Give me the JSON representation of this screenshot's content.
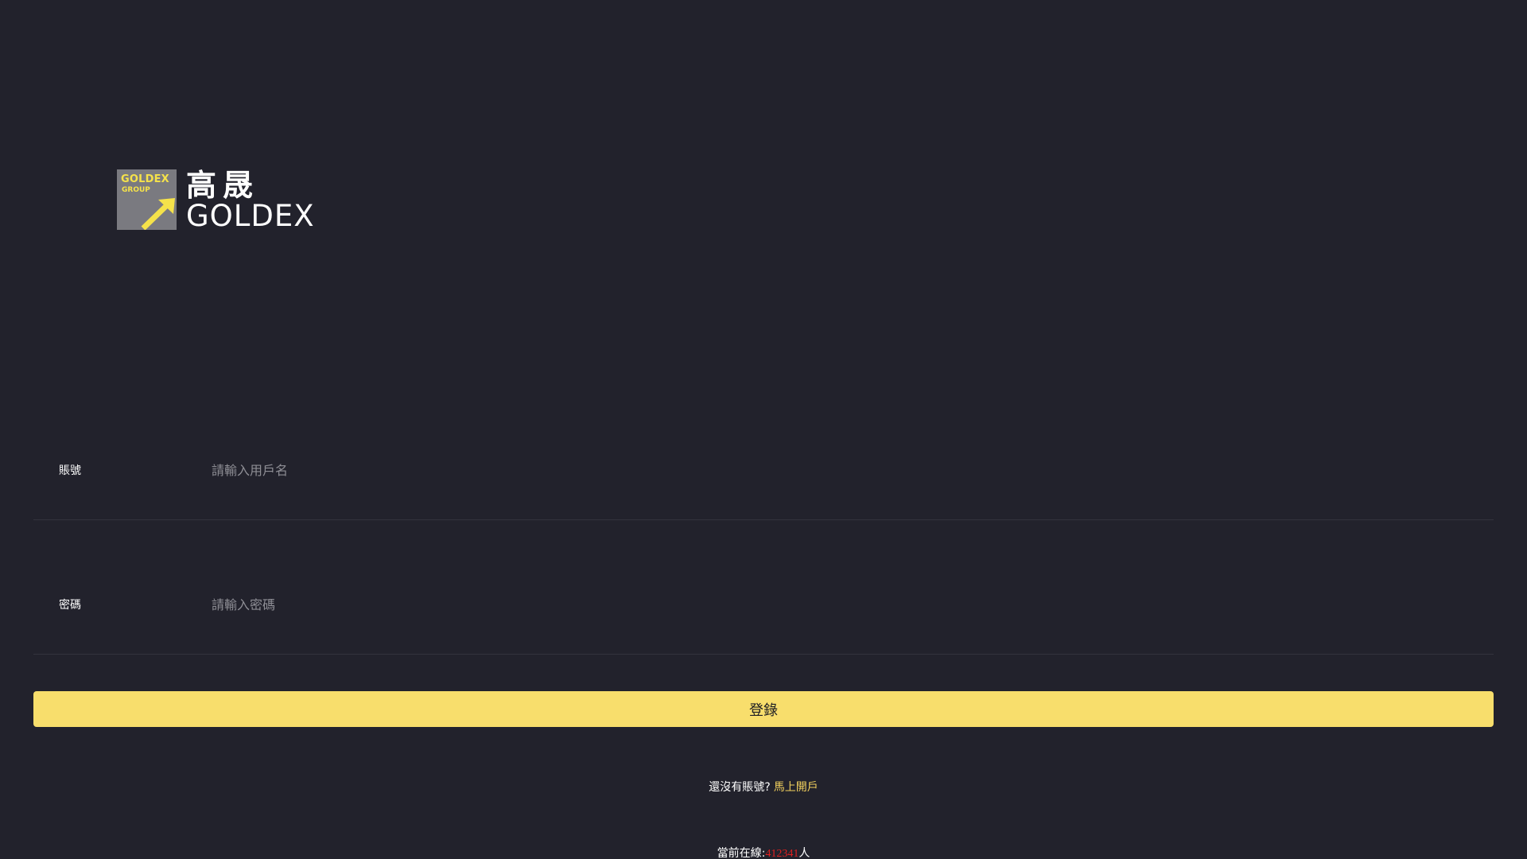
{
  "logo": {
    "badge_title": "GOLDEX",
    "badge_sub": "GROUP",
    "name_cn": "高晟",
    "name_en": "GOLDEX",
    "colors": {
      "badge_bg": "#7a7a80",
      "accent": "#f5e24a"
    }
  },
  "form": {
    "account_label": "賬號",
    "account_placeholder": "請輸入用戶名",
    "account_value": "",
    "password_label": "密碼",
    "password_placeholder": "請輸入密碼",
    "password_value": "",
    "login_label": "登錄"
  },
  "register": {
    "prompt": "還沒有賬號?",
    "link": "馬上開戶"
  },
  "online": {
    "prefix": "當前在線:",
    "count": "412341",
    "suffix": "人"
  },
  "colors": {
    "background": "#22222c",
    "button": "#f8de6c",
    "link": "#f3d15e",
    "count": "#e02020"
  }
}
